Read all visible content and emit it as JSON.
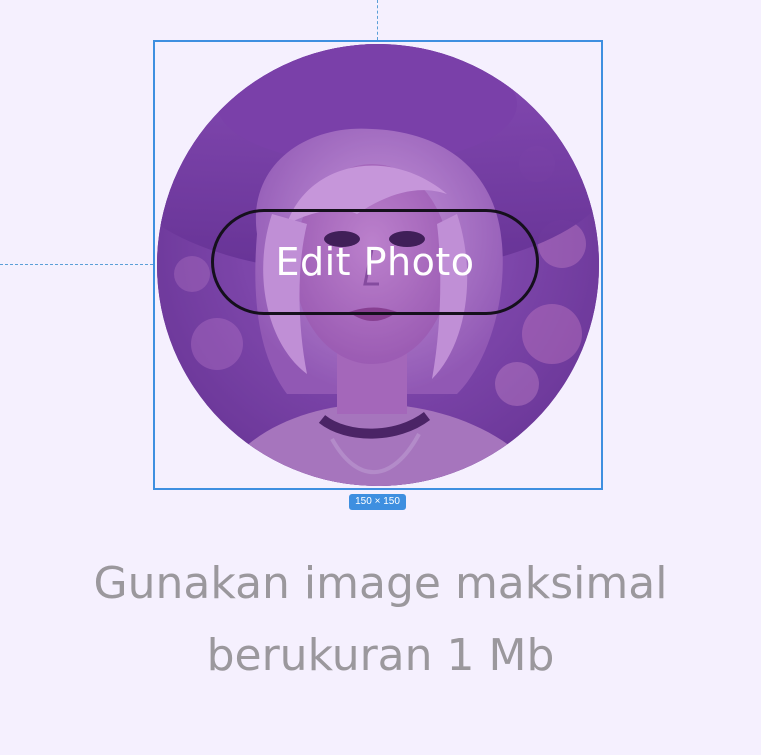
{
  "avatar": {
    "icon": "avatar-photo",
    "edit_label": "Edit Photo",
    "size_badge": "150 × 150"
  },
  "helper": {
    "line1": "Gunakan image maksimal",
    "line2": "berukuran 1 Mb"
  },
  "colors": {
    "background": "#f5f0fe",
    "selection": "#3e8fe0",
    "text_muted": "#9b989d",
    "overlay": "#7a3fae"
  }
}
